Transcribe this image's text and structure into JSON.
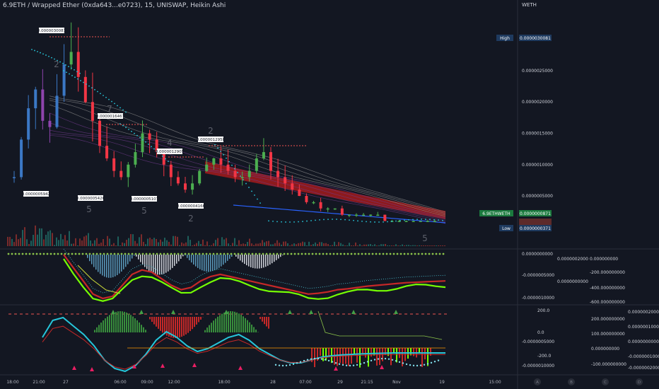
{
  "header": {
    "title": "6.9ETH / Wrapped Ether (0xda643...e0723), 15, UNISWAP, Heikin Ashi",
    "unit": "WETH"
  },
  "colors": {
    "background": "#131722",
    "up": "#26a69a",
    "down": "#ef5350",
    "green_bar": "#4caf50",
    "red_bar": "#f23645",
    "cyan": "#26c6da",
    "yellow": "#cddc39",
    "neon_green": "#76ff03",
    "cloud_red": "#b71c1c"
  },
  "price_badges": [
    {
      "label": "High",
      "value": "0.0000030081",
      "bg": "#1e3a5f"
    },
    {
      "label": "6.9ETHWETH",
      "value": "0.0000000871",
      "bg": "#1b7a3e"
    },
    {
      "label": "Low",
      "value": "0.0000000371",
      "bg": "#1e3a5f"
    }
  ],
  "chart_data": [
    {
      "type": "candlestick",
      "title": "6.9ETH / Wrapped Ether (0xda643...e0723), 15, UNISWAP, Heikin Ashi",
      "y_ticks": [
        "0.0000025000",
        "0.0000020000",
        "0.0000015000",
        "0.0000010000",
        "0.0000005000"
      ],
      "ylim": [
        3.71e-08,
        3.0081e-06
      ],
      "x_ticks": [
        "18:00",
        "21:00",
        "27",
        "06:00",
        "09:00",
        "12:00",
        "18:00",
        "28",
        "07:00",
        "29",
        "21:15",
        "Nov",
        "19",
        "15:00"
      ],
      "price_labels": [
        {
          "text": "0.0000030081",
          "kind": "high"
        },
        {
          "text": "0.0000016467",
          "kind": "high"
        },
        {
          "text": "0.0000012909",
          "kind": "high"
        },
        {
          "text": "0.0000012958",
          "kind": "high"
        },
        {
          "text": "0.0000005942",
          "kind": "low"
        },
        {
          "text": "0.0000005426",
          "kind": "low"
        },
        {
          "text": "0.0000005107",
          "kind": "low"
        },
        {
          "text": "0.0000004166",
          "kind": "low"
        }
      ],
      "count_labels": [
        "2",
        "7",
        "4",
        "2",
        "5",
        "5",
        "2",
        "5"
      ],
      "close_series": [
        8e-07,
        1.4e-06,
        1.9e-06,
        2.2e-06,
        1.7e-06,
        1.6e-06,
        2.1e-06,
        2.6e-06,
        2.8e-06,
        2.4e-06,
        2e-06,
        1.7e-06,
        1.3e-06,
        1.1e-06,
        9e-07,
        8e-07,
        1e-06,
        1.2e-06,
        1.5e-06,
        1.4e-06,
        1.2e-06,
        1e-06,
        8e-07,
        7e-07,
        6e-07,
        7e-07,
        9e-07,
        1e-06,
        1.1e-06,
        1e-06,
        9e-07,
        8e-07,
        8e-07,
        9e-07,
        1.1e-06,
        1.2e-06,
        9e-07,
        8e-07,
        7e-07,
        6e-07,
        5e-07,
        4e-07,
        4e-07,
        3e-07,
        3e-07,
        3e-07,
        2e-07,
        2e-07,
        2e-07,
        2e-07,
        2e-07,
        2e-07,
        1e-07,
        1e-07,
        1e-07,
        1e-07,
        1e-07,
        1e-07,
        1e-07,
        1e-07
      ]
    },
    {
      "type": "area",
      "name": "oscillator-1",
      "right_axis_1": [
        "0.0000000000",
        "-0.0000005000",
        "-0.0000010000"
      ],
      "right_axis_2": [
        "0.0000002000",
        "0.0000000000"
      ],
      "right_axis_3": [
        "0.000000000",
        "-200.000000000",
        "-400.000000000",
        "-600.000000000"
      ],
      "values": [
        0,
        -0.3,
        -0.6,
        -0.9,
        -1.0,
        -0.95,
        -0.7,
        -0.45,
        -0.35,
        -0.4,
        -0.55,
        -0.7,
        -0.8,
        -0.75,
        -0.6,
        -0.5,
        -0.45,
        -0.5,
        -0.55,
        -0.6,
        -0.65,
        -0.7,
        -0.75,
        -0.8,
        -0.85,
        -0.9,
        -0.88,
        -0.85,
        -0.8,
        -0.78,
        -0.75,
        -0.72,
        -0.7,
        -0.68,
        -0.66,
        -0.64,
        -0.63,
        -0.62,
        -0.61,
        -0.6
      ]
    },
    {
      "type": "line",
      "name": "oscillator-2",
      "right_axis_1": [
        "200.0",
        "0.0",
        "-200.0"
      ],
      "right_axis_2": [
        "-0.0000005000",
        "-0.0000010000"
      ],
      "right_axis_3": [
        "200.000000000",
        "100.000000000",
        "0.000000000",
        "-100.000000000"
      ],
      "right_axis_4": [
        "0.0000002000",
        "0.0000001000",
        "0.0000000000",
        "-0.0000001000",
        "-0.0000002000"
      ],
      "values": [
        0.2,
        0.8,
        0.9,
        0.6,
        0.3,
        -0.1,
        -0.6,
        -0.9,
        -1.0,
        -0.8,
        -0.4,
        0.1,
        0.4,
        0.2,
        -0.1,
        -0.3,
        -0.2,
        0.0,
        0.2,
        0.3,
        0.1,
        -0.2,
        -0.4,
        -0.6,
        -0.7,
        -0.7,
        -0.6,
        -0.5,
        -0.45,
        -0.42,
        -0.4,
        -0.38,
        -0.37,
        -0.36,
        -0.35,
        -0.35,
        -0.35,
        -0.35,
        -0.35,
        -0.35
      ]
    }
  ],
  "footer": {
    "compare_letters": [
      "A",
      "B",
      "C",
      "D"
    ]
  }
}
